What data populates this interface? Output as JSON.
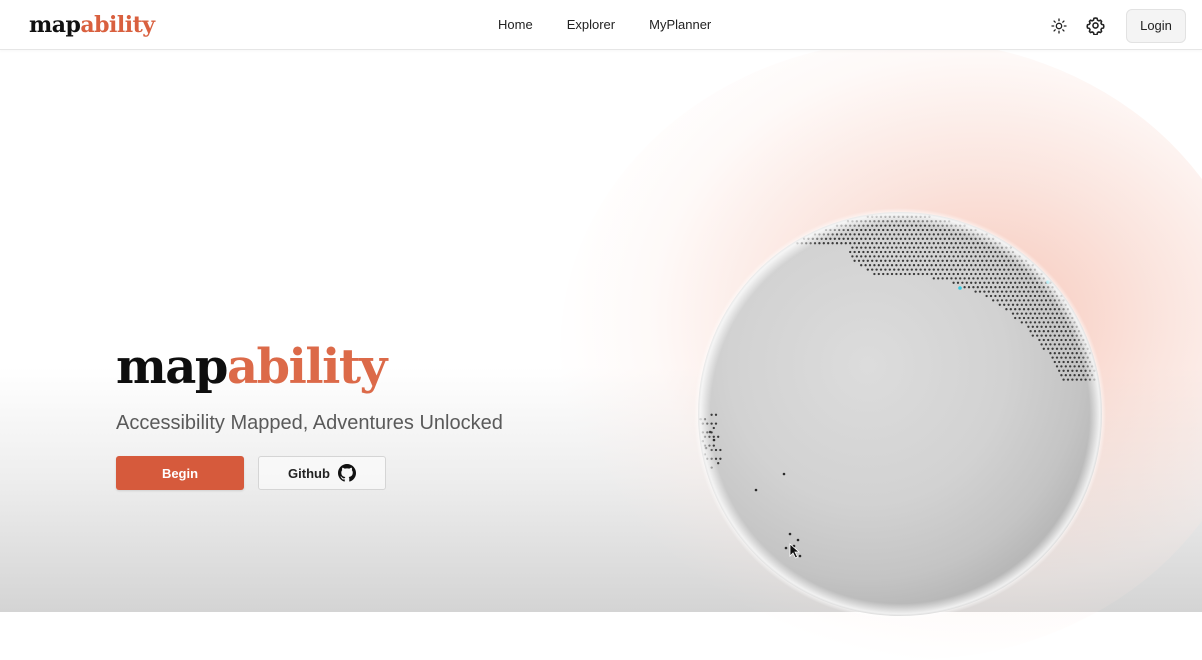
{
  "nav": {
    "brand_dark": "map",
    "brand_accent": "ability",
    "links": [
      "Home",
      "Explorer",
      "MyPlanner"
    ],
    "theme_icon": "sun-icon",
    "settings_icon": "gear-icon",
    "login_label": "Login"
  },
  "hero": {
    "title_dark": "map",
    "title_accent": "ability",
    "tagline": "Accessibility Mapped, Adventures Unlocked",
    "begin_label": "Begin",
    "github_label": "Github",
    "github_icon": "github-icon"
  },
  "globe": {
    "icon": "interactive-globe"
  },
  "colors": {
    "accent": "#d65a3c",
    "brand_accent": "#dc6a49",
    "glow": "#f6c4b5"
  }
}
